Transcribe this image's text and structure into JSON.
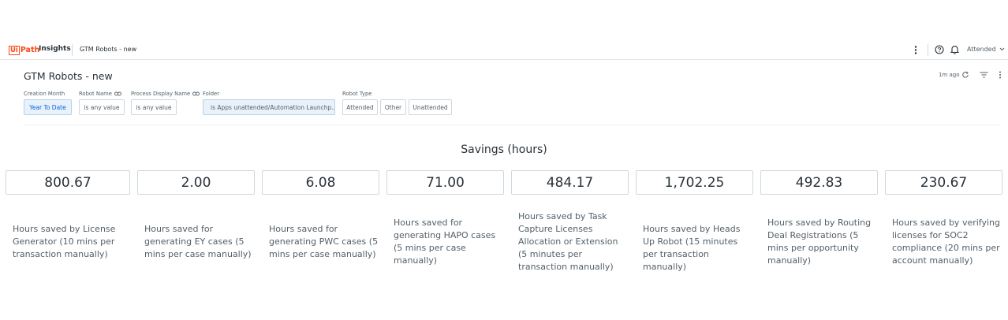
{
  "header": {
    "logo_box": "Ui",
    "logo_path": "Path",
    "app_name": "Insights",
    "breadcrumb": "GTM Robots - new",
    "user_label": "Attended"
  },
  "dashboard": {
    "title": "GTM Robots - new",
    "last_updated": "1m ago"
  },
  "filters": {
    "creation_month": {
      "label": "Creation Month",
      "value": "Year To Date"
    },
    "robot_name": {
      "label": "Robot Name",
      "value": "is any value"
    },
    "process_display_name": {
      "label": "Process Display Name",
      "value": "is any value"
    },
    "folder": {
      "label": "Folder",
      "value": "is Apps unattended/Automation Launchp..."
    },
    "robot_type": {
      "label": "Robot Type",
      "options": [
        "Attended",
        "Other",
        "Unattended"
      ]
    }
  },
  "savings": {
    "title": "Savings (hours)",
    "tiles": [
      {
        "value": "800.67",
        "desc": "Hours saved by License Generator (10 mins per transaction manually)"
      },
      {
        "value": "2.00",
        "desc": "Hours saved for generating EY cases (5 mins per case manually)"
      },
      {
        "value": "6.08",
        "desc": "Hours saved for generating PWC cases (5 mins per case manually)"
      },
      {
        "value": "71.00",
        "desc": "Hours saved for generating HAPO cases (5 mins per case manually)"
      },
      {
        "value": "484.17",
        "desc": "Hours saved by Task Capture Licenses Allocation or Extension (5 minutes per transaction manually)"
      },
      {
        "value": "1,702.25",
        "desc": "Hours saved by Heads Up Robot (15 minutes per transaction manually)"
      },
      {
        "value": "492.83",
        "desc": "Hours saved by Routing Deal Registrations (5 mins per opportunity manually)"
      },
      {
        "value": "230.67",
        "desc": "Hours saved by verifying licenses for SOC2 compliance (20 mins per account manually)"
      }
    ]
  },
  "icons": {
    "more": "more-vertical-icon",
    "help": "help-icon",
    "bell": "notification-bell-icon",
    "chevron": "chevron-down-icon",
    "refresh": "refresh-icon",
    "filter": "filter-icon",
    "link": "link-icon"
  },
  "colors": {
    "brand": "#fa4616",
    "accent": "#0067df",
    "active_bg": "#e9f1fa"
  }
}
